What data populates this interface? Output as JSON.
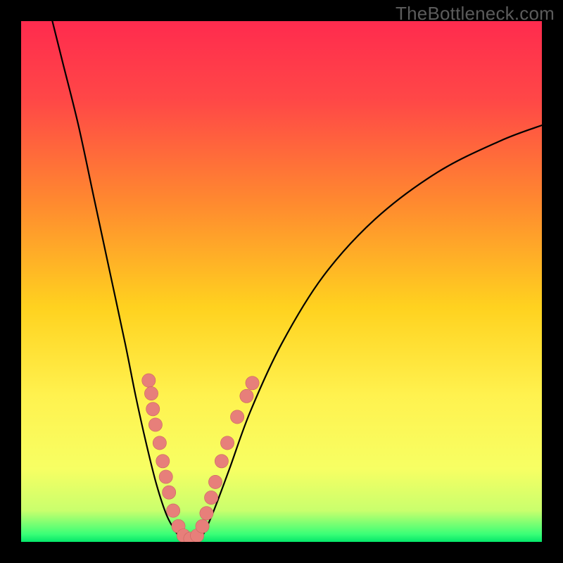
{
  "watermark": "TheBottleneck.com",
  "colors": {
    "black": "#000000",
    "curve": "#000000",
    "marker_fill": "#e77f7a",
    "marker_stroke": "#c96661",
    "gradient_stops": [
      {
        "offset": 0.0,
        "color": "#ff2b4e"
      },
      {
        "offset": 0.15,
        "color": "#ff4747"
      },
      {
        "offset": 0.35,
        "color": "#ff8a2f"
      },
      {
        "offset": 0.55,
        "color": "#ffd21f"
      },
      {
        "offset": 0.72,
        "color": "#fff24f"
      },
      {
        "offset": 0.86,
        "color": "#f7ff63"
      },
      {
        "offset": 0.94,
        "color": "#c9ff6d"
      },
      {
        "offset": 0.985,
        "color": "#3bff77"
      },
      {
        "offset": 1.0,
        "color": "#05e66a"
      }
    ]
  },
  "chart_data": {
    "type": "line",
    "title": "",
    "xlabel": "",
    "ylabel": "",
    "xlim": [
      0,
      100
    ],
    "ylim": [
      0,
      100
    ],
    "curve": [
      {
        "x": 6.0,
        "y": 100.0
      },
      {
        "x": 8.0,
        "y": 92.0
      },
      {
        "x": 11.0,
        "y": 80.0
      },
      {
        "x": 14.0,
        "y": 66.0
      },
      {
        "x": 17.0,
        "y": 52.0
      },
      {
        "x": 20.0,
        "y": 38.0
      },
      {
        "x": 22.0,
        "y": 28.0
      },
      {
        "x": 24.0,
        "y": 19.0
      },
      {
        "x": 26.0,
        "y": 11.0
      },
      {
        "x": 28.0,
        "y": 5.0
      },
      {
        "x": 30.0,
        "y": 1.5
      },
      {
        "x": 31.0,
        "y": 0.5
      },
      {
        "x": 32.5,
        "y": 0.2
      },
      {
        "x": 34.0,
        "y": 0.5
      },
      {
        "x": 35.0,
        "y": 1.5
      },
      {
        "x": 37.0,
        "y": 6.0
      },
      {
        "x": 40.0,
        "y": 14.0
      },
      {
        "x": 44.0,
        "y": 25.0
      },
      {
        "x": 50.0,
        "y": 38.0
      },
      {
        "x": 58.0,
        "y": 51.0
      },
      {
        "x": 68.0,
        "y": 62.0
      },
      {
        "x": 80.0,
        "y": 71.0
      },
      {
        "x": 92.0,
        "y": 77.0
      },
      {
        "x": 100.0,
        "y": 80.0
      }
    ],
    "markers": [
      {
        "x": 24.5,
        "y": 31.0,
        "r": 1.3
      },
      {
        "x": 25.0,
        "y": 28.5,
        "r": 1.3
      },
      {
        "x": 25.3,
        "y": 25.5,
        "r": 1.3
      },
      {
        "x": 25.8,
        "y": 22.5,
        "r": 1.3
      },
      {
        "x": 26.6,
        "y": 19.0,
        "r": 1.3
      },
      {
        "x": 27.2,
        "y": 15.5,
        "r": 1.3
      },
      {
        "x": 27.8,
        "y": 12.5,
        "r": 1.3
      },
      {
        "x": 28.4,
        "y": 9.5,
        "r": 1.3
      },
      {
        "x": 29.2,
        "y": 6.0,
        "r": 1.3
      },
      {
        "x": 30.2,
        "y": 3.0,
        "r": 1.3
      },
      {
        "x": 31.2,
        "y": 1.2,
        "r": 1.3
      },
      {
        "x": 32.5,
        "y": 0.6,
        "r": 1.3
      },
      {
        "x": 33.8,
        "y": 1.2,
        "r": 1.3
      },
      {
        "x": 34.8,
        "y": 3.0,
        "r": 1.3
      },
      {
        "x": 35.6,
        "y": 5.5,
        "r": 1.3
      },
      {
        "x": 36.5,
        "y": 8.5,
        "r": 1.3
      },
      {
        "x": 37.3,
        "y": 11.5,
        "r": 1.3
      },
      {
        "x": 38.5,
        "y": 15.5,
        "r": 1.3
      },
      {
        "x": 39.6,
        "y": 19.0,
        "r": 1.3
      },
      {
        "x": 41.5,
        "y": 24.0,
        "r": 1.3
      },
      {
        "x": 43.3,
        "y": 28.0,
        "r": 1.3
      },
      {
        "x": 44.4,
        "y": 30.5,
        "r": 1.3
      }
    ]
  }
}
